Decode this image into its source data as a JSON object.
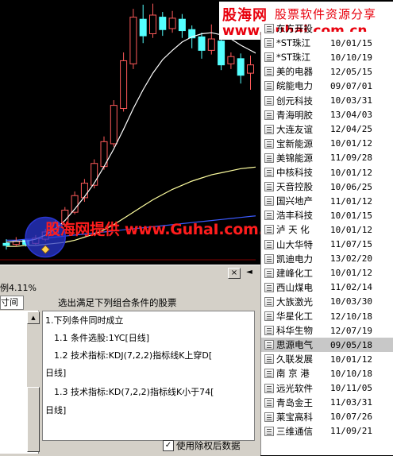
{
  "logo": {
    "brand": "股海网",
    "slogan": "股票软件资源分享",
    "url": "www.Guhai.com.cn"
  },
  "watermark": "股海网提供 www.GuhaI.com.CN",
  "stock_list": [
    {
      "name": "东方开投",
      "date": ""
    },
    {
      "name": "*ST珠江",
      "date": "10/01/15"
    },
    {
      "name": "*ST珠江",
      "date": "10/10/19"
    },
    {
      "name": "美的电器",
      "date": "12/05/15"
    },
    {
      "name": "皖能电力",
      "date": "09/07/01"
    },
    {
      "name": "创元科技",
      "date": "10/03/31"
    },
    {
      "name": "青海明胶",
      "date": "13/04/03"
    },
    {
      "name": "大连友谊",
      "date": "12/04/25"
    },
    {
      "name": "宝新能源",
      "date": "10/01/12"
    },
    {
      "name": "美锦能源",
      "date": "11/09/28"
    },
    {
      "name": "中核科技",
      "date": "10/01/12"
    },
    {
      "name": "天音控股",
      "date": "10/06/25"
    },
    {
      "name": "国兴地产",
      "date": "11/01/12"
    },
    {
      "name": "浩丰科技",
      "date": "10/01/15"
    },
    {
      "name": "泸 天 化",
      "date": "10/01/12"
    },
    {
      "name": "山大华特",
      "date": "11/07/15"
    },
    {
      "name": "凯迪电力",
      "date": "13/02/20"
    },
    {
      "name": "建峰化工",
      "date": "10/01/12"
    },
    {
      "name": "西山煤电",
      "date": "11/02/14"
    },
    {
      "name": "大族激光",
      "date": "10/03/30"
    },
    {
      "name": "华星化工",
      "date": "12/10/18"
    },
    {
      "name": "科华生物",
      "date": "12/07/19"
    },
    {
      "name": "思源电气",
      "date": "09/05/18"
    },
    {
      "name": "久联发展",
      "date": "10/01/12"
    },
    {
      "name": "南 京 港",
      "date": "10/10/18"
    },
    {
      "name": "远光软件",
      "date": "10/11/05"
    },
    {
      "name": "青岛金王",
      "date": "11/03/31"
    },
    {
      "name": "莱宝高科",
      "date": "10/07/26"
    },
    {
      "name": "三维通信",
      "date": "11/09/21"
    }
  ],
  "selected_index": 22,
  "dialog": {
    "close_label": "×",
    "arrow_label": "◄",
    "ratio_text": "例4.11%",
    "tab_time": "寸间",
    "heading": "选出满足下列组合条件的股票",
    "conditions": [
      "1.下列条件同时成立",
      "1.1 条件选股:1YC[日线]",
      "1.2 技术指标:KDJ(7,2,2)指标线K上穿D[",
      "日线]",
      "1.3 技术指标:KD(7,2,2)指标线K小于74[",
      "日线]"
    ],
    "checkbox_checked": true,
    "checkbox_label": "使用除权后数据"
  },
  "colors": {
    "candle_up": "#ff5a5a",
    "candle_down": "#54ffff",
    "ma_short": "#ffffff",
    "ma_mid": "#ffffa0",
    "ma_long": "#3c5aff",
    "marker_circle": "#2a37d2"
  },
  "candles": [
    {
      "open": 9.2,
      "close": 9.0,
      "high": 9.6,
      "low": 8.6
    },
    {
      "open": 9.1,
      "close": 9.4,
      "high": 9.8,
      "low": 8.9
    },
    {
      "open": 9.5,
      "close": 9.1,
      "high": 9.7,
      "low": 8.9
    },
    {
      "open": 9.2,
      "close": 9.7,
      "high": 10.0,
      "low": 9.0
    },
    {
      "open": 9.6,
      "close": 10.3,
      "high": 10.6,
      "low": 9.4
    },
    {
      "open": 10.2,
      "close": 11.2,
      "high": 11.5,
      "low": 10.0
    },
    {
      "open": 11.0,
      "close": 12.4,
      "high": 12.7,
      "low": 10.8
    },
    {
      "open": 12.2,
      "close": 13.8,
      "high": 14.2,
      "low": 12.0
    },
    {
      "open": 13.6,
      "close": 15.0,
      "high": 15.4,
      "low": 13.2
    },
    {
      "open": 14.8,
      "close": 16.9,
      "high": 17.3,
      "low": 14.5
    },
    {
      "open": 16.6,
      "close": 19.0,
      "high": 19.5,
      "low": 16.3
    },
    {
      "open": 18.8,
      "close": 22.5,
      "high": 23.0,
      "low": 18.5
    },
    {
      "open": 22.2,
      "close": 26.8,
      "high": 27.6,
      "low": 21.9
    },
    {
      "open": 26.5,
      "close": 31.0,
      "high": 31.8,
      "low": 26.0
    },
    {
      "open": 30.8,
      "close": 29.2,
      "high": 32.2,
      "low": 28.5
    },
    {
      "open": 29.4,
      "close": 31.2,
      "high": 32.3,
      "low": 29.0
    },
    {
      "open": 31.0,
      "close": 29.8,
      "high": 31.5,
      "low": 29.2
    },
    {
      "open": 29.9,
      "close": 30.9,
      "high": 31.6,
      "low": 29.5
    },
    {
      "open": 30.8,
      "close": 29.7,
      "high": 31.3,
      "low": 29.0
    },
    {
      "open": 29.8,
      "close": 29.0,
      "high": 30.2,
      "low": 28.0
    },
    {
      "open": 29.1,
      "close": 27.8,
      "high": 29.5,
      "low": 27.0
    },
    {
      "open": 27.8,
      "close": 28.9,
      "high": 30.3,
      "low": 27.4
    },
    {
      "open": 28.7,
      "close": 26.4,
      "high": 29.3,
      "low": 25.9
    },
    {
      "open": 26.5,
      "close": 27.2,
      "high": 27.6,
      "low": 26.0
    },
    {
      "open": 27.0,
      "close": 25.4,
      "high": 27.5,
      "low": 24.6
    },
    {
      "open": 25.6,
      "close": 26.4,
      "high": 27.3,
      "low": 24.0
    },
    {
      "open": 26.3,
      "close": 25.3,
      "high": 26.6,
      "low": 24.6
    }
  ],
  "ma_short": [
    9.3,
    9.4,
    9.4,
    9.6,
    10.0,
    10.6,
    11.4,
    12.5,
    13.7,
    15.0,
    16.6,
    18.3,
    20.2,
    22.2,
    24.0,
    25.6,
    26.9,
    27.8,
    28.6,
    29.1,
    29.4,
    29.5,
    29.3,
    28.9,
    28.3,
    27.8,
    27.3
  ],
  "ma_mid": [
    8.9,
    8.9,
    9.0,
    9.0,
    9.1,
    9.2,
    9.3,
    9.5,
    9.8,
    10.1,
    10.5,
    11.0,
    11.6,
    12.2,
    12.8,
    13.4,
    13.9,
    14.4,
    14.8,
    15.2,
    15.5,
    15.8,
    16.0,
    16.2,
    16.4,
    16.5,
    16.6
  ],
  "ma_long": [
    9.5,
    9.5,
    9.6,
    9.6,
    9.7,
    9.8,
    9.9,
    10.0,
    10.1,
    10.2,
    10.3,
    10.4,
    10.5,
    10.6,
    10.7,
    10.8,
    10.9,
    11.0,
    11.1,
    11.2,
    11.3,
    11.4,
    11.5,
    11.6,
    11.7,
    11.8,
    11.9
  ],
  "price_range": [
    8.0,
    32.5
  ]
}
